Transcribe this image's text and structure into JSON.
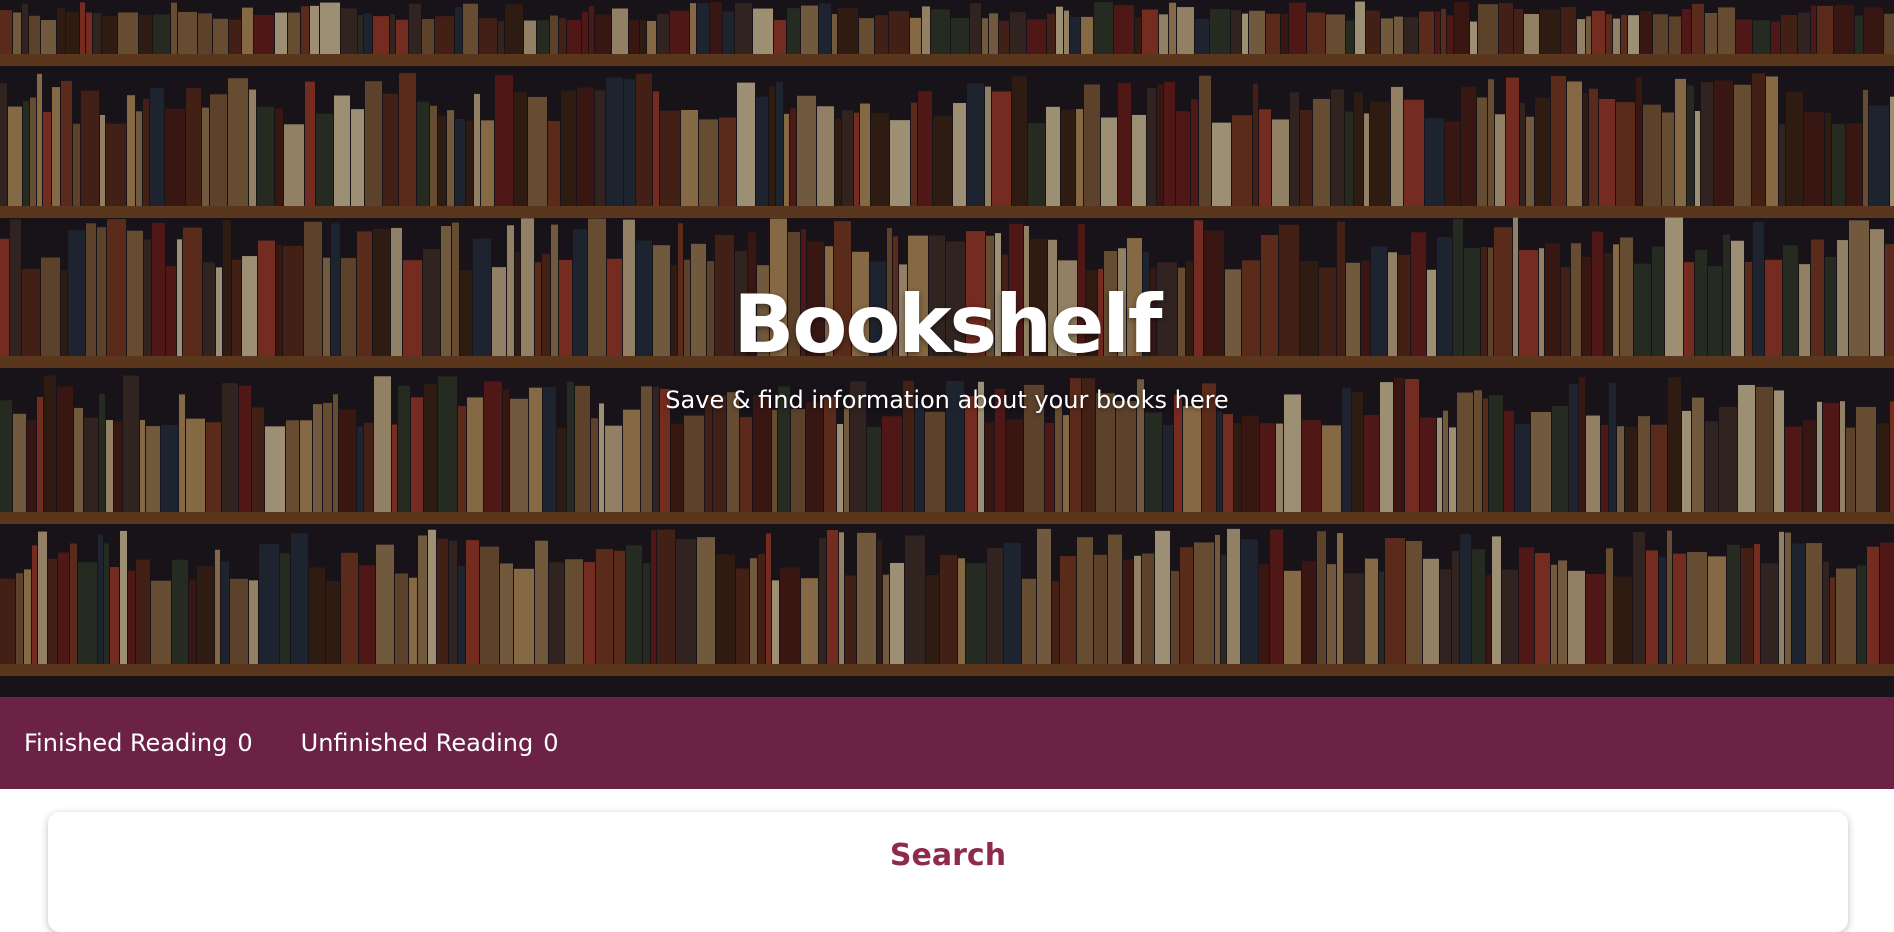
{
  "hero": {
    "title": "Bookshelf",
    "subtitle": "Save & find information about your books here",
    "background_image": "library-bookshelf-photo",
    "colors": {
      "overlay": "#1a1414"
    }
  },
  "stats": {
    "finished_label": "Finished Reading",
    "finished_count": "0",
    "unfinished_label": "Unfinished Reading",
    "unfinished_count": "0",
    "background": "#6b2246"
  },
  "search": {
    "title": "Search",
    "title_color": "#8f2b4a"
  }
}
